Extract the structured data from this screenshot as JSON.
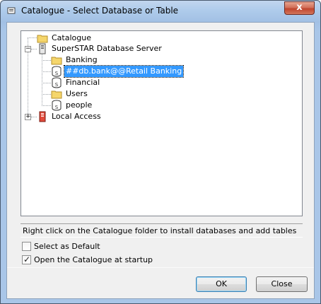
{
  "window": {
    "title": "Catalogue - Select Database or Table",
    "close_label": "x"
  },
  "tree": {
    "items": [
      {
        "label": "Catalogue",
        "icon": "folder-icon"
      },
      {
        "label": "SuperSTAR Database Server",
        "icon": "server-icon",
        "expander": "−"
      },
      {
        "label": "Banking",
        "icon": "folder-icon"
      },
      {
        "label": "##db.bank@@Retail Banking",
        "icon": "database-icon",
        "selected": true
      },
      {
        "label": "Financial",
        "icon": "database-icon"
      },
      {
        "label": "Users",
        "icon": "folder-icon"
      },
      {
        "label": "people",
        "icon": "database-icon"
      },
      {
        "label": "Local Access",
        "icon": "local-server-icon",
        "expander": "+"
      }
    ]
  },
  "hint": "Right click on the Catalogue folder to install databases and add tables",
  "options": {
    "select_default": {
      "label": "Select as Default",
      "checked": false
    },
    "open_at_startup": {
      "label": "Open the Catalogue at startup",
      "checked": true,
      "mark": "✓"
    }
  },
  "buttons": {
    "ok": "OK",
    "close": "Close"
  },
  "colors": {
    "selection": "#3399ff",
    "folder": "#f5d66c",
    "close_button": "#c7503a"
  }
}
